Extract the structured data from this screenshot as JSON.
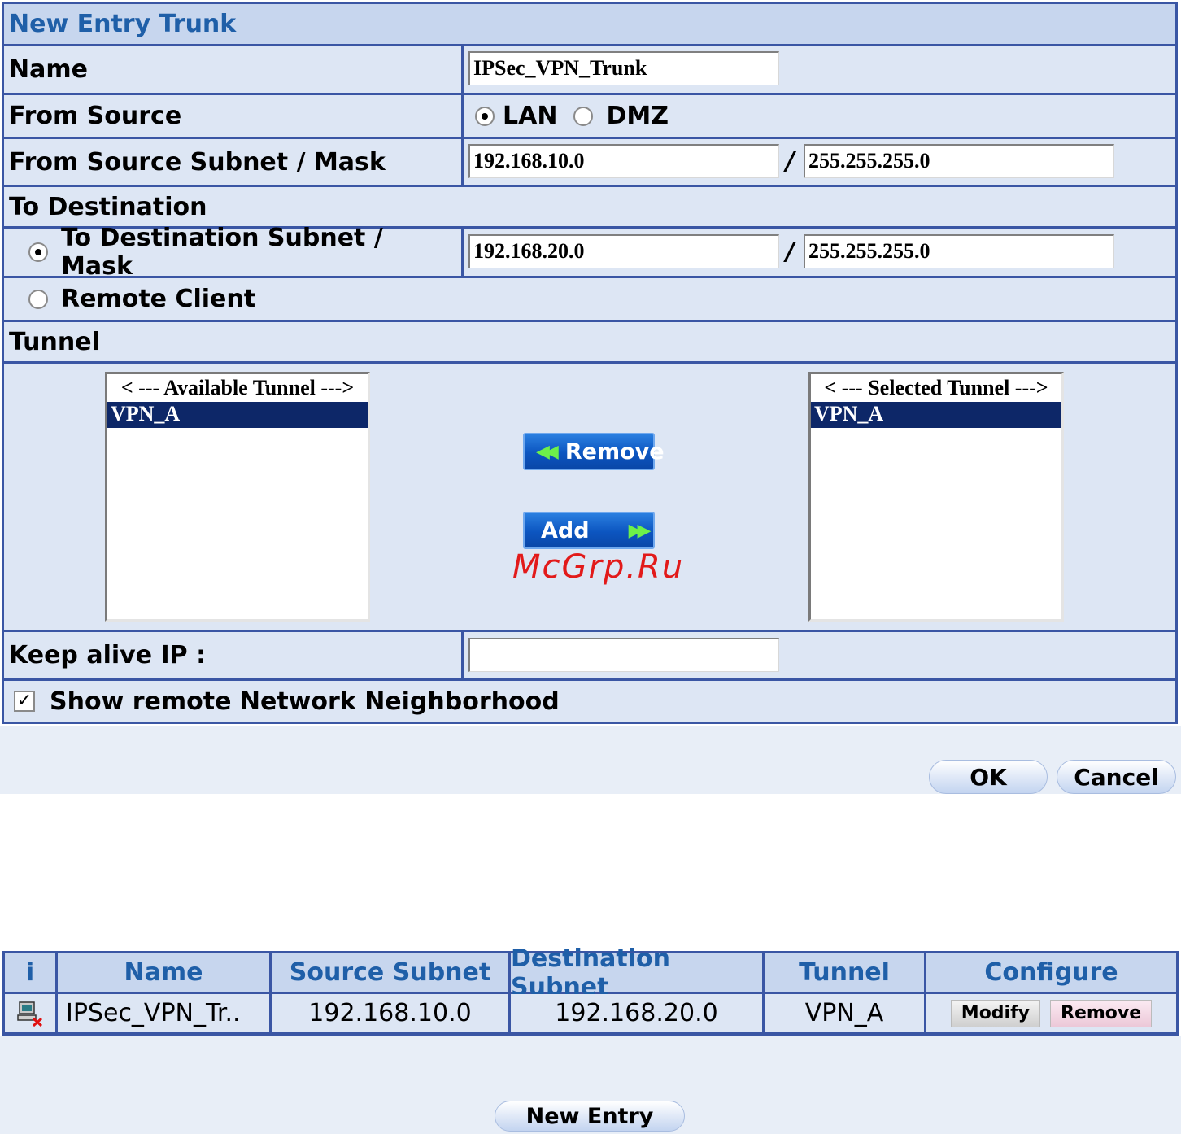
{
  "form": {
    "title": "New Entry Trunk",
    "name_label": "Name",
    "name_value": "IPSec_VPN_Trunk",
    "from_source_label": "From Source",
    "source_option_lan": "LAN",
    "source_option_dmz": "DMZ",
    "source_selected": "LAN",
    "src_subnet_label": "From Source Subnet / Mask",
    "src_subnet_value": "192.168.10.0",
    "src_mask_value": "255.255.255.0",
    "to_destination_label": "To Destination",
    "dest_subnet_label": "To Destination Subnet / Mask",
    "dest_subnet_value": "192.168.20.0",
    "dest_mask_value": "255.255.255.0",
    "remote_client_label": "Remote Client",
    "destination_selected": "subnet",
    "separator": "/",
    "tunnel_label": "Tunnel",
    "available_header": "< --- Available Tunnel --->",
    "available_items": [
      "VPN_A"
    ],
    "selected_header": "< --- Selected Tunnel --->",
    "selected_items": [
      "VPN_A"
    ],
    "remove_label": "Remove",
    "add_label": "Add",
    "keep_alive_label": "Keep alive IP :",
    "keep_alive_value": "",
    "show_neighborhood_label": "Show remote Network Neighborhood",
    "show_neighborhood_checked": true,
    "ok_label": "OK",
    "cancel_label": "Cancel"
  },
  "watermark": "McGrp.Ru",
  "table": {
    "headers": [
      "i",
      "Name",
      "Source Subnet",
      "Destination Subnet",
      "Tunnel",
      "Configure"
    ],
    "row": {
      "icon": "computer-remove-icon",
      "name": "IPSec_VPN_Tr..",
      "source_subnet": "192.168.10.0",
      "destination_subnet": "192.168.20.0",
      "tunnel": "VPN_A",
      "modify_label": "Modify",
      "remove_label": "Remove"
    },
    "new_entry_label": "New Entry"
  },
  "colors": {
    "border": "#3a56a4",
    "header_bg": "#c7d6ee",
    "header_text": "#1f5fa8",
    "cell_bg": "#dde6f4",
    "list_selected": "#0d2768",
    "watermark": "#e21a1a"
  }
}
